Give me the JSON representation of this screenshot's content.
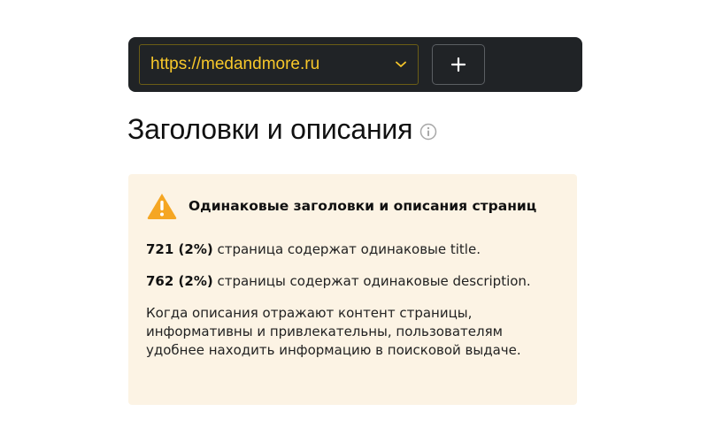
{
  "toolbar": {
    "site_url": "https://medandmore.ru",
    "add_label": "+"
  },
  "section": {
    "title": "Заголовки и описания"
  },
  "warning": {
    "title": "Одинаковые заголовки и описания страниц",
    "title_stat": {
      "count": "721 (2%)",
      "text": " страница содержат одинаковые title."
    },
    "description_stat": {
      "count": "762 (2%)",
      "text": " страницы содержат одинаковые description."
    },
    "explanation": "Когда описания отражают контент страницы, информативны и привлекательны, пользователям удобнее находить информацию в поисковой выдаче."
  },
  "colors": {
    "toolbar_bg": "#202326",
    "accent_yellow": "#f7c72a",
    "warning_bg": "#fcf3e4",
    "warning_icon": "#f5a623"
  }
}
